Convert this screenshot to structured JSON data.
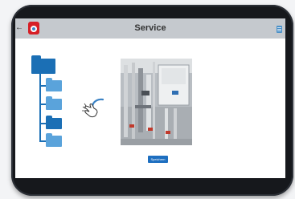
{
  "app": {
    "title": "Service",
    "logo_icon": "app-logo-icon",
    "back_icon": "back-arrow-icon",
    "back_glyph": "←",
    "doc_icon": "document-icon"
  },
  "folder_tree": {
    "root": {
      "icon": "folder-icon"
    },
    "children": [
      {
        "icon": "folder-icon",
        "state": "normal"
      },
      {
        "icon": "folder-icon",
        "state": "normal"
      },
      {
        "icon": "folder-icon",
        "state": "selected"
      },
      {
        "icon": "folder-icon",
        "state": "normal"
      }
    ]
  },
  "gesture": {
    "icon": "tap-hand-icon"
  },
  "photo": {
    "description_icon": "equipment-photo"
  },
  "actions": {
    "save_label": "Speichern"
  },
  "colors": {
    "titlebar": "#c5c9ce",
    "folder_dark": "#1b6fb5",
    "folder_light": "#5aa3db",
    "button": "#1e6fc0",
    "logo": "#d61f26"
  }
}
